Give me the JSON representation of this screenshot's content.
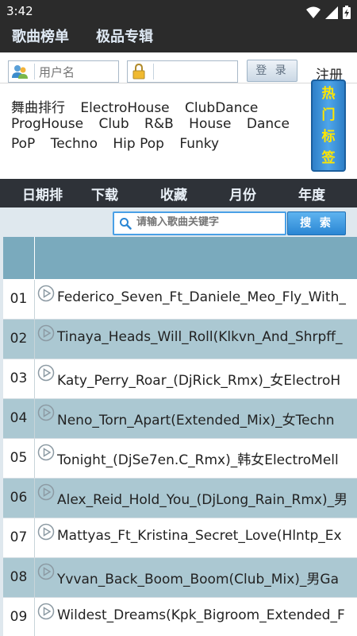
{
  "status_bar": {
    "time": "3:42"
  },
  "header": {
    "tabs": [
      "歌曲榜单",
      "极品专辑"
    ]
  },
  "login": {
    "username_placeholder": "用户名",
    "password_placeholder": "",
    "login_label": "登 录",
    "register_label": "注册"
  },
  "tags": {
    "lines": [
      [
        "舞曲排行",
        "ElectroHouse",
        "ClubDance"
      ],
      [
        "ProgHouse",
        "Club",
        "R&B",
        "House",
        "Dance"
      ],
      [
        "PoP",
        "Techno",
        "Hip Pop",
        "Funky"
      ]
    ],
    "hot_tags_label": [
      "热",
      "门",
      "标",
      "签"
    ]
  },
  "sort_bar": {
    "items": [
      "日期排",
      "下载",
      "收藏",
      "月份",
      "年度"
    ]
  },
  "search": {
    "placeholder": "请输入歌曲关键字",
    "button_label": "搜 索"
  },
  "songs": [
    {
      "num": "01",
      "title": "Federico_Seven_Ft_Daniele_Meo_Fly_With_"
    },
    {
      "num": "02",
      "title": "Tinaya_Heads_Will_Roll(Klkvn_And_Shrpff_"
    },
    {
      "num": "03",
      "title": "Katy_Perry_Roar_(DjRick_Rmx)_女ElectroH"
    },
    {
      "num": "04",
      "title": "Neno_Torn_Apart(Extended_Mix)_女Techn"
    },
    {
      "num": "05",
      "title": "Tonight_(DjSe7en.C_Rmx)_韩女ElectroMell"
    },
    {
      "num": "06",
      "title": "Alex_Reid_Hold_You_(DjLong_Rain_Rmx)_男"
    },
    {
      "num": "07",
      "title": "Mattyas_Ft_Kristina_Secret_Love(Hlntp_Ex"
    },
    {
      "num": "08",
      "title": "Yvvan_Back_Boom_Boom(Club_Mix)_男Ga"
    },
    {
      "num": "09",
      "title": "Wildest_Dreams(Kpk_Bigroom_Extended_F"
    }
  ],
  "colors": {
    "header_bg": "#2b2b2b",
    "sort_bar_bg": "#2e3238",
    "row_alt": "#abc8d2",
    "table_header": "#7aaabd",
    "hot_tag_text": "#ffe600",
    "search_accent": "#4aa0e6"
  },
  "icons": {
    "wifi": "wifi-icon",
    "signal": "signal-icon",
    "battery": "battery-icon",
    "user": "user-icon",
    "lock": "lock-icon",
    "search": "search-icon",
    "play": "play-icon"
  }
}
